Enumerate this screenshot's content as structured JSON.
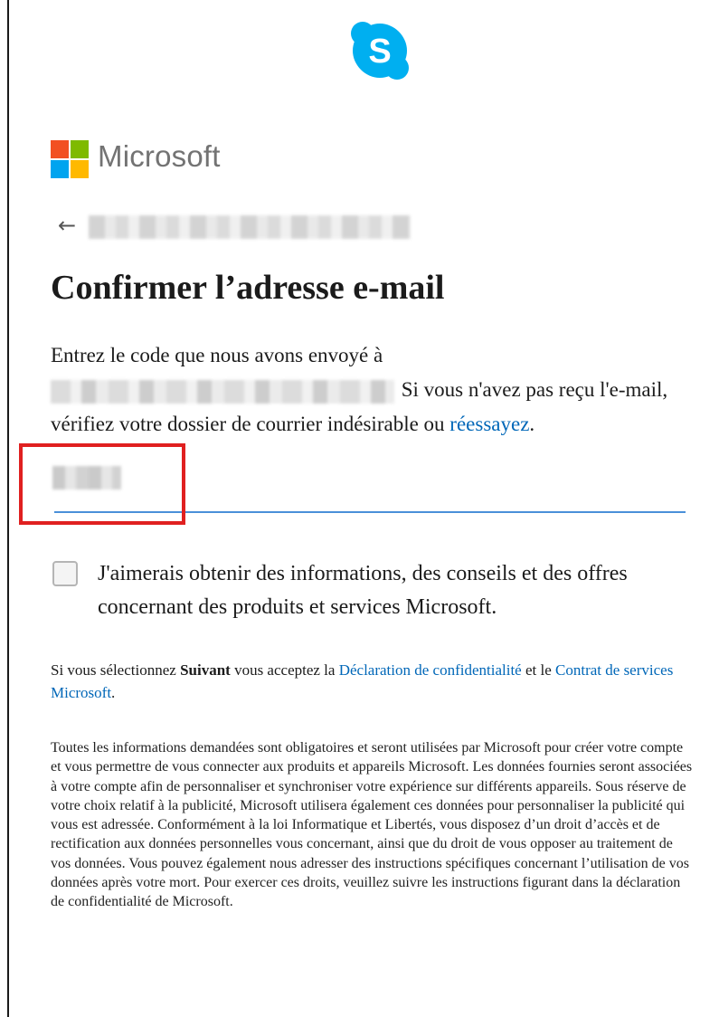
{
  "app": {
    "logo": "skype-logo",
    "brand_name": "Microsoft"
  },
  "colors": {
    "skype": "#00aff0",
    "link": "#0067b8",
    "ms_red": "#f25022",
    "ms_green": "#7fba00",
    "ms_blue": "#00a4ef",
    "ms_yellow": "#ffb900",
    "highlight": "#e02020"
  },
  "header": {
    "back_icon": "arrow-left-icon",
    "back_glyph": "←"
  },
  "page": {
    "title": "Confirmer l’adresse e-mail"
  },
  "description": {
    "line1": "Entrez le code que nous avons envoyé à",
    "after_email": "Si vous n'avez pas reçu l'e-mail, vérifiez votre dossier de courrier indésirable ou",
    "retry_link": "réessayez",
    "end": "."
  },
  "code_input": {
    "value_redacted": true
  },
  "consent": {
    "label": "J'aimerais obtenir des informations, des conseils et des offres concernant des produits et services Microsoft.",
    "checked": false
  },
  "notice": {
    "prefix": "Si vous sélectionnez",
    "strong": "Suivant",
    "middle": "vous acceptez la",
    "privacy_link": "Déclaration de confidentialité",
    "conj": "et le",
    "terms_link": "Contrat de services Microsoft",
    "end": "."
  },
  "legal": {
    "text": "Toutes les informations demandées sont obligatoires et seront utilisées par Microsoft pour créer votre compte et vous permettre de vous connecter aux produits et appareils Microsoft. Les données fournies seront associées à votre compte afin de personnaliser et synchroniser votre expérience sur différents appareils. Sous réserve de votre choix relatif à la publicité, Microsoft utilisera également ces données pour personnaliser la publicité qui vous est adressée. Conformément à la loi Informatique et Libertés, vous disposez d’un droit d’accès et de rectification aux données personnelles vous concernant, ainsi que du droit de vous opposer au traitement de vos données. Vous pouvez également nous adresser des instructions spécifiques concernant l’utilisation de vos données après votre mort. Pour exercer ces droits, veuillez suivre les instructions figurant dans la déclaration de confidentialité de Microsoft."
  }
}
